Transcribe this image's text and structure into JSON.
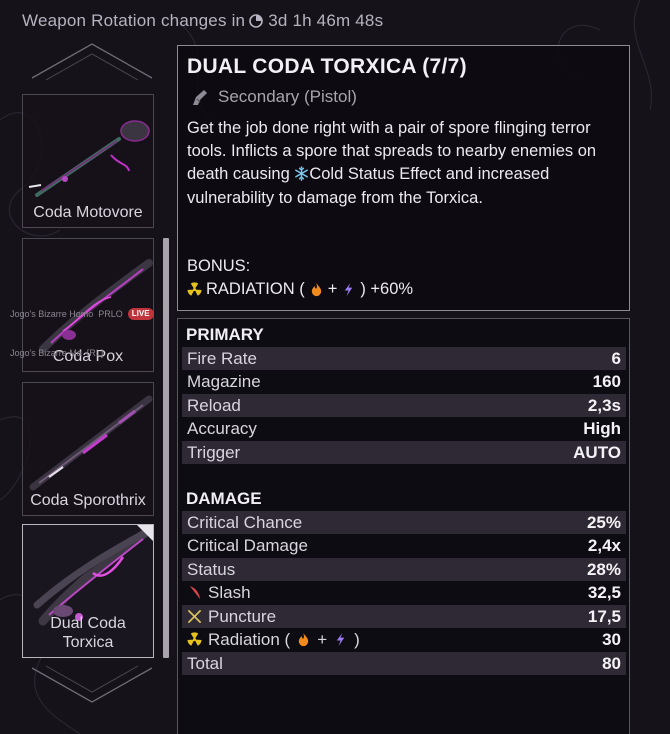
{
  "header": {
    "rotation_text": "Weapon Rotation changes in",
    "countdown": "3d 1h 46m 48s",
    "icon": "clock-icon"
  },
  "weapons": [
    {
      "name": "Coda Motovore",
      "selected": false
    },
    {
      "name": "Coda Pox",
      "selected": false
    },
    {
      "name": "Coda Sporothrix",
      "selected": false
    },
    {
      "name": "Dual Coda Torxica",
      "selected": true
    }
  ],
  "stream_overlay": {
    "row1_name": "Jogo's Bizarre Homo",
    "row1_tag": "PRLO",
    "live_label": "LIVE",
    "row2_name": "Jogo's Bizarre Ma",
    "row2_tag": "[RL]"
  },
  "detail": {
    "title": "DUAL CODA TORXICA (7/7)",
    "type": "Secondary (Pistol)",
    "type_icon": "pistol-icon",
    "description_pre": "Get the job done right with a pair of spore flinging terror tools. Inflicts a spore that spreads to nearby enemies on death causing",
    "description_cold": "Cold Status Effect and increased vulnerability to damage from the Torxica.",
    "bonus_label": "BONUS:",
    "bonus_element": "RADIATION (",
    "bonus_plus": "+",
    "bonus_close": ") +60%"
  },
  "primary": {
    "heading": "PRIMARY",
    "rows": [
      {
        "label": "Fire Rate",
        "value": "6"
      },
      {
        "label": "Magazine",
        "value": "160"
      },
      {
        "label": "Reload",
        "value": "2,3s"
      },
      {
        "label": "Accuracy",
        "value": "High"
      },
      {
        "label": "Trigger",
        "value": "AUTO"
      }
    ]
  },
  "damage": {
    "heading": "DAMAGE",
    "rows": [
      {
        "label": "Critical Chance",
        "value": "25%"
      },
      {
        "label": "Critical Damage",
        "value": "2,4x"
      },
      {
        "label": "Status",
        "value": "28%"
      },
      {
        "label": "Slash",
        "value": "32,5",
        "icon": "slash-icon"
      },
      {
        "label": "Puncture",
        "value": "17,5",
        "icon": "puncture-icon"
      },
      {
        "label": "Radiation (",
        "value": "30",
        "icon": "radiation-icon",
        "plus": "+",
        "close": ")"
      },
      {
        "label": "Total",
        "value": "80"
      }
    ]
  },
  "colors": {
    "radiation": "#e5c21c",
    "heat": "#f08a1c",
    "electricity": "#9b7cf0",
    "cold": "#7ec8ee",
    "slash": "#d7464a",
    "puncture": "#d8c25c"
  }
}
